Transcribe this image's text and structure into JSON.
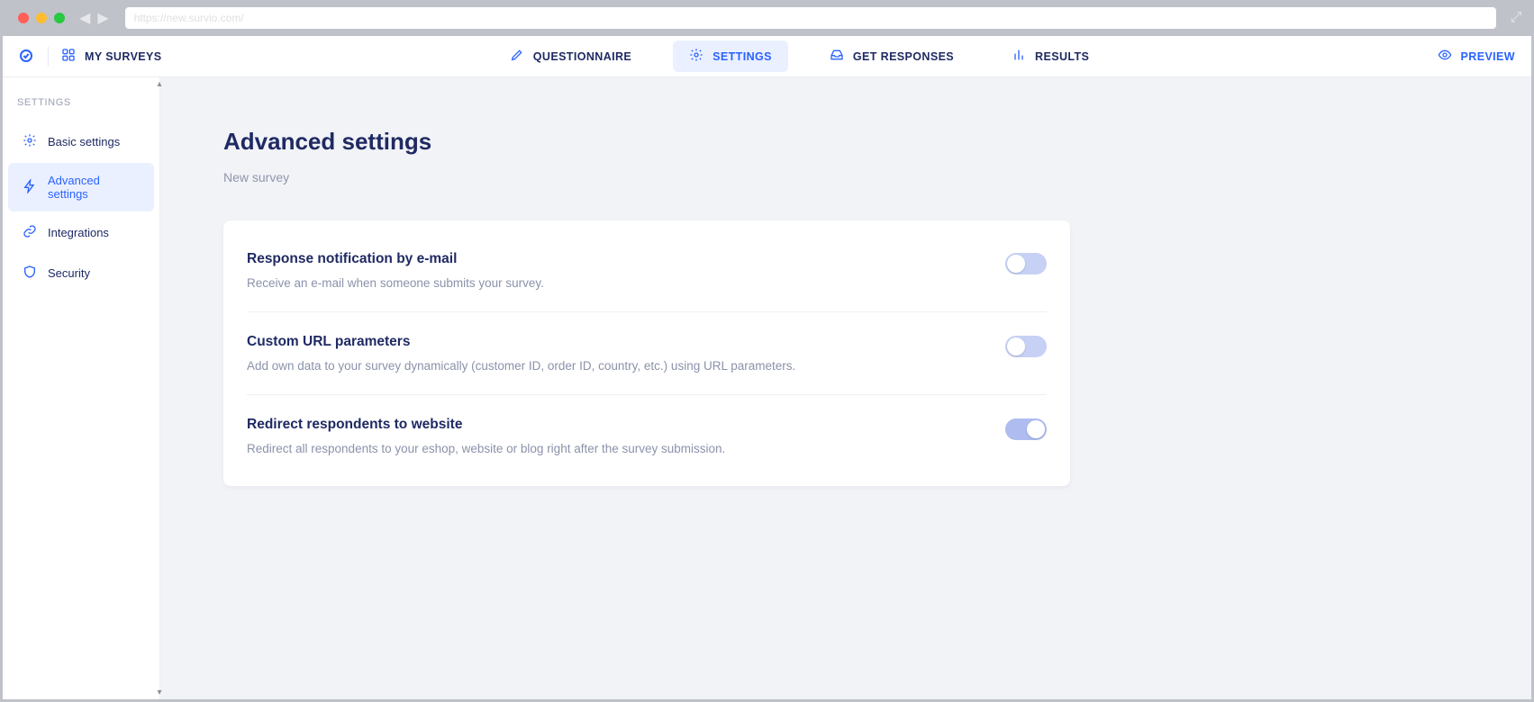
{
  "chrome": {
    "url_placeholder": "https://new.survio.com/",
    "traffic_colors": [
      "#ff5f57",
      "#febc2e",
      "#28c840"
    ]
  },
  "topbar": {
    "my_surveys_label": "MY SURVEYS",
    "tabs": [
      {
        "label": "QUESTIONNAIRE",
        "icon": "pencil"
      },
      {
        "label": "SETTINGS",
        "icon": "gear",
        "active": true
      },
      {
        "label": "GET RESPONSES",
        "icon": "inbox"
      },
      {
        "label": "RESULTS",
        "icon": "bars"
      }
    ],
    "preview_label": "PREVIEW"
  },
  "sidebar": {
    "section_label": "SETTINGS",
    "items": [
      {
        "label": "Basic settings",
        "icon": "gear"
      },
      {
        "label": "Advanced settings",
        "icon": "bolt",
        "active": true
      },
      {
        "label": "Integrations",
        "icon": "link"
      },
      {
        "label": "Security",
        "icon": "shield"
      }
    ]
  },
  "page": {
    "title": "Advanced settings",
    "subtitle": "New survey"
  },
  "settings": [
    {
      "title": "Response notification by e-mail",
      "desc": "Receive an e-mail when someone submits your survey.",
      "on": false
    },
    {
      "title": "Custom URL parameters",
      "desc": "Add own data to your survey dynamically (customer ID, order ID, country, etc.) using URL parameters.",
      "on": false
    },
    {
      "title": "Redirect respondents to website",
      "desc": "Redirect all respondents to your eshop, website or blog right after the survey submission.",
      "on": true
    }
  ]
}
